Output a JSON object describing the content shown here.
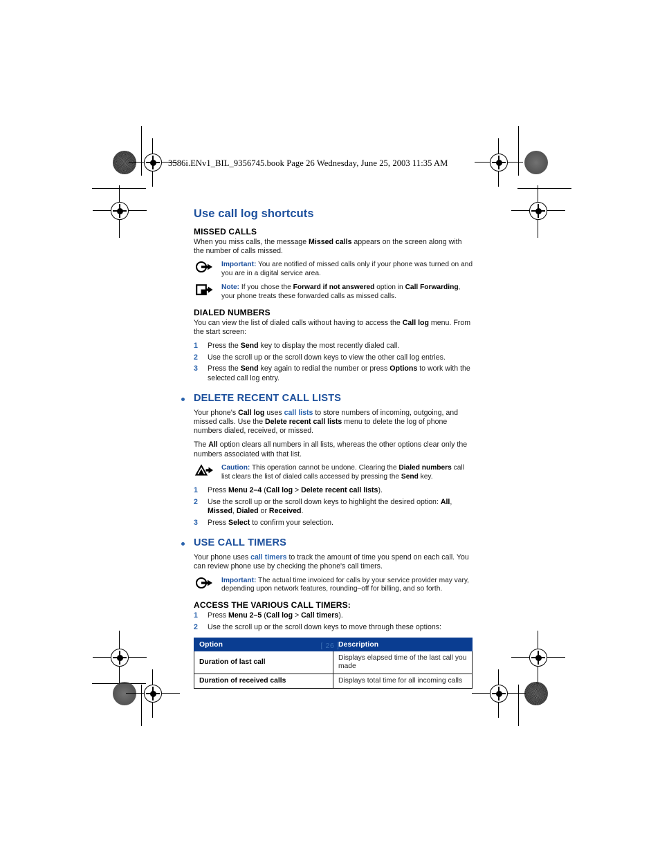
{
  "print_header": {
    "text": "3586i.ENv1_BIL_9356745.book  Page 26  Wednesday, June 25, 2003  11:35 AM"
  },
  "folio": "[ 26 ]",
  "colors": {
    "heading_blue": "#1c4f9c",
    "accent_blue": "#2a63ad",
    "table_header_bg": "#0a3d91",
    "table_header_fg": "#ffffff",
    "body_text": "#1a1a1a"
  },
  "page_title": "Use call log shortcuts",
  "sections": {
    "missed_calls": {
      "heading": "MISSED CALLS",
      "body_1": "When you miss calls, the message ",
      "body_1_bold": "Missed calls",
      "body_1_tail": " appears on the screen along with the number of calls missed.",
      "important": {
        "icon": "important-circle-arrow-icon",
        "label": "Important:",
        "text": " You are notified of missed calls only if your phone was turned on and you are in a digital service area."
      },
      "note": {
        "icon": "note-square-arrow-icon",
        "label": "Note:",
        "text_1": " If you chose the ",
        "bold_1": "Forward if not answered",
        "text_2": " option in ",
        "bold_2": "Call Forwarding",
        "text_3": ", your phone treats these forwarded calls as missed calls."
      }
    },
    "dialed_numbers": {
      "heading": "DIALED NUMBERS",
      "body_1": "You can view the list of dialed calls without having to access the ",
      "body_1_bold": "Call log",
      "body_1_tail": " menu. From the start screen:",
      "steps": [
        {
          "num": "1",
          "parts": [
            {
              "t": "Press the ",
              "b": false
            },
            {
              "t": "Send",
              "b": true
            },
            {
              "t": " key to display the most recently dialed call.",
              "b": false
            }
          ]
        },
        {
          "num": "2",
          "parts": [
            {
              "t": "Use the scroll up or the scroll down keys to view the other call log entries.",
              "b": false
            }
          ]
        },
        {
          "num": "3",
          "parts": [
            {
              "t": "Press the ",
              "b": false
            },
            {
              "t": "Send",
              "b": true
            },
            {
              "t": " key again to redial the number or press ",
              "b": false
            },
            {
              "t": "Options",
              "b": true
            },
            {
              "t": " to work with the selected call log entry.",
              "b": false
            }
          ]
        }
      ]
    },
    "delete_recent_call_lists": {
      "heading": "DELETE RECENT CALL LISTS",
      "para_1_parts": [
        {
          "t": "Your phone's ",
          "b": false
        },
        {
          "t": "Call log",
          "b": true
        },
        {
          "t": " uses ",
          "b": false
        },
        {
          "t": "call lists",
          "x": true
        },
        {
          "t": " to store numbers of incoming, outgoing, and missed calls. Use the ",
          "b": false
        },
        {
          "t": "Delete recent call lists",
          "b": true
        },
        {
          "t": " menu to delete the log of phone numbers dialed, received, or missed.",
          "b": false
        }
      ],
      "para_2_parts": [
        {
          "t": "The ",
          "b": false
        },
        {
          "t": "All",
          "b": true
        },
        {
          "t": " option clears all numbers in all lists, whereas the other options clear only the numbers associated with that list.",
          "b": false
        }
      ],
      "caution": {
        "icon": "caution-triangle-arrow-icon",
        "label": "Caution:",
        "parts": [
          {
            "t": " This operation cannot be undone. Clearing the ",
            "b": false
          },
          {
            "t": "Dialed numbers",
            "b": true
          },
          {
            "t": " call list clears the list of dialed calls accessed by pressing the ",
            "b": false
          },
          {
            "t": "Send",
            "b": true
          },
          {
            "t": " key.",
            "b": false
          }
        ]
      },
      "steps": [
        {
          "num": "1",
          "parts": [
            {
              "t": "Press ",
              "b": false
            },
            {
              "t": "Menu 2–4",
              "b": true
            },
            {
              "t": " (",
              "b": false
            },
            {
              "t": "Call log",
              "b": true
            },
            {
              "t": " > ",
              "b": false
            },
            {
              "t": "Delete recent call lists",
              "b": true
            },
            {
              "t": ").",
              "b": false
            }
          ]
        },
        {
          "num": "2",
          "parts": [
            {
              "t": "Use the scroll up or the scroll down keys to highlight the desired option: ",
              "b": false
            },
            {
              "t": "All",
              "b": true
            },
            {
              "t": ", ",
              "b": false
            },
            {
              "t": "Missed",
              "b": true
            },
            {
              "t": ", ",
              "b": false
            },
            {
              "t": "Dialed",
              "b": true
            },
            {
              "t": " or ",
              "b": false
            },
            {
              "t": "Received",
              "b": true
            },
            {
              "t": ".",
              "b": false
            }
          ]
        },
        {
          "num": "3",
          "parts": [
            {
              "t": "Press ",
              "b": false
            },
            {
              "t": "Select",
              "b": true
            },
            {
              "t": " to confirm your selection.",
              "b": false
            }
          ]
        }
      ]
    },
    "use_call_timers": {
      "heading": "USE CALL TIMERS",
      "para_1_parts": [
        {
          "t": "Your phone uses ",
          "b": false
        },
        {
          "t": "call timers",
          "x": true
        },
        {
          "t": " to track the amount of time you spend on each call. You can review phone use by checking the phone's call timers.",
          "b": false
        }
      ],
      "important": {
        "icon": "important-circle-arrow-icon",
        "label": "Important:",
        "text": " The actual time invoiced for calls by your service provider may vary, depending upon network features, rounding–off for billing, and so forth."
      },
      "sub_heading": "ACCESS THE VARIOUS CALL TIMERS:",
      "steps": [
        {
          "num": "1",
          "parts": [
            {
              "t": "Press ",
              "b": false
            },
            {
              "t": "Menu 2–5",
              "b": true
            },
            {
              "t": " (",
              "b": false
            },
            {
              "t": "Call log",
              "b": true
            },
            {
              "t": " > ",
              "b": false
            },
            {
              "t": "Call timers",
              "b": true
            },
            {
              "t": ").",
              "b": false
            }
          ]
        },
        {
          "num": "2",
          "parts": [
            {
              "t": "Use the scroll up or the scroll down keys to move through these options:",
              "b": false
            }
          ]
        }
      ],
      "table": {
        "headers": [
          "Option",
          "Description"
        ],
        "rows": [
          [
            "Duration of last call",
            "Displays elapsed time of the last call you made"
          ],
          [
            "Duration of received calls",
            "Displays total time for all incoming calls"
          ]
        ]
      }
    }
  }
}
